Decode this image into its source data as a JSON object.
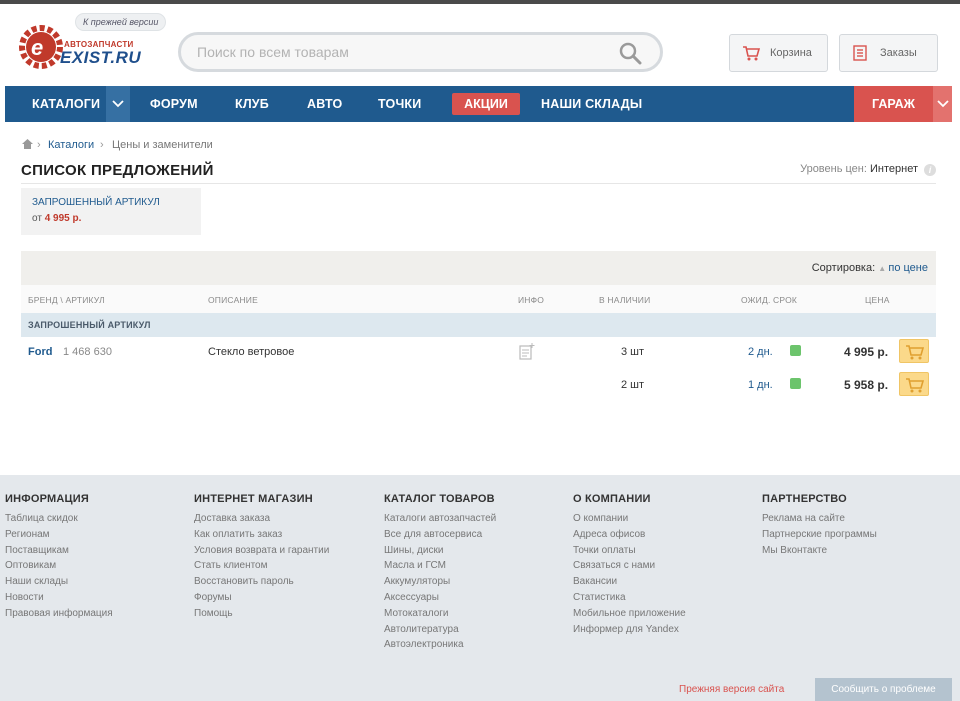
{
  "header": {
    "old_version": "К прежней версии",
    "logo_sub": "АВТОЗАПЧАСТИ",
    "logo_name": "EXIST.RU",
    "search_placeholder": "Поиск по всем товарам",
    "cart_label": "Корзина",
    "orders_label": "Заказы"
  },
  "nav": {
    "items": [
      "КАТАЛОГИ",
      "ФОРУМ",
      "КЛУБ",
      "АВТО",
      "ТОЧКИ",
      "АКЦИИ",
      "НАШИ СКЛАДЫ"
    ],
    "garage": "ГАРАЖ"
  },
  "breadcrumb": [
    "Каталоги",
    "Цены и заменители"
  ],
  "page": {
    "title": "СПИСОК ПРЕДЛОЖЕНИЙ",
    "price_level_label": "Уровень цен:",
    "price_level_value": "Интернет"
  },
  "requested": {
    "label": "ЗАПРОШЕННЫЙ АРТИКУЛ",
    "from": "от",
    "price": "4 995 р."
  },
  "table": {
    "sort_label": "Сортировка:",
    "sort_value": "по цене",
    "columns": [
      "БРЕНД \\ АРТИКУЛ",
      "ОПИСАНИЕ",
      "ИНФО",
      "В НАЛИЧИИ",
      "ОЖИД. СРОК",
      "ЦЕНА"
    ],
    "group_label": "ЗАПРОШЕННЫЙ АРТИКУЛ",
    "rows": [
      {
        "brand": "Ford",
        "article": "1 468 630",
        "description": "Стекло ветровое",
        "qty": "3 шт",
        "term": "2 дн.",
        "price": "4 995 р."
      },
      {
        "brand": "",
        "article": "",
        "description": "",
        "qty": "2 шт",
        "term": "1 дн.",
        "price": "5 958 р."
      }
    ]
  },
  "footer": {
    "columns": [
      {
        "title": "ИНФОРМАЦИЯ",
        "links": [
          "Таблица скидок",
          "Регионам",
          "Поставщикам",
          "Оптовикам",
          "Наши склады",
          "Новости",
          "Правовая информация"
        ]
      },
      {
        "title": "ИНТЕРНЕТ МАГАЗИН",
        "links": [
          "Доставка заказа",
          "Как оплатить заказ",
          "Условия возврата и гарантии",
          "Стать клиентом",
          "Восстановить пароль",
          "Форумы",
          "Помощь"
        ]
      },
      {
        "title": "КАТАЛОГ ТОВАРОВ",
        "links": [
          "Каталоги автозапчастей",
          "Все для автосервиса",
          "Шины, диски",
          "Масла и ГСМ",
          "Аккумуляторы",
          "Аксессуары",
          "Мотокаталоги",
          "Автолитература",
          "Автоэлектроника"
        ]
      },
      {
        "title": "О КОМПАНИИ",
        "links": [
          "О компании",
          "Адреса офисов",
          "Точки оплаты",
          "Связаться с нами",
          "Вакансии",
          "Статистика",
          "Мобильное приложение",
          "Информер для Yandex"
        ]
      },
      {
        "title": "ПАРТНЕРСТВО",
        "links": [
          "Реклама на сайте",
          "Партнерские программы",
          "Мы Вконтакте"
        ]
      }
    ],
    "old_site": "Прежняя версия сайта",
    "report": "Сообщить о проблеме"
  },
  "colors": {
    "nav_bg": "#1f5a8e",
    "accent_red": "#d9534f",
    "link_blue": "#1f5a8e",
    "in_stock": "#6cc46c",
    "cart_button": "#fbd98a"
  }
}
